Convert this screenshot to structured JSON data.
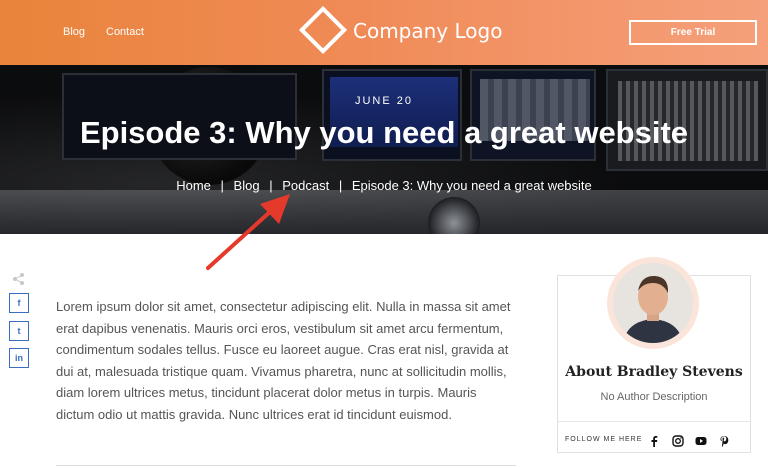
{
  "header": {
    "nav": {
      "blog": "Blog",
      "contact": "Contact"
    },
    "logo_text": "Company Logo",
    "trial_button": "Free Trial"
  },
  "hero": {
    "date": "JUNE 20",
    "title": "Episode 3: Why you need a great website",
    "breadcrumb": {
      "home": "Home",
      "blog": "Blog",
      "podcast": "Podcast",
      "current": "Episode 3: Why you need a great website",
      "separator": "|"
    }
  },
  "article": {
    "body": "Lorem ipsum dolor sit amet, consectetur adipiscing elit. Nulla in massa sit amet erat dapibus venenatis. Mauris orci eros, vestibulum sit amet arcu fermentum, condimentum sodales tellus. Fusce eu laoreet augue. Cras erat nisl, gravida at dui at, malesuada tristique quam. Vivamus pharetra, nunc at sollicitudin mollis, diam lorem ultrices metus, tincidunt placerat dolor metus in turpis. Mauris dictum odio ut mattis gravida. Nunc ultrices erat id tincidunt euismod."
  },
  "share": {
    "icons": [
      "share-icon",
      "facebook-icon",
      "twitter-icon",
      "linkedin-icon"
    ],
    "labels": {
      "facebook": "f",
      "twitter": "t",
      "linkedin": "in"
    }
  },
  "author": {
    "name": "About Bradley Stevens",
    "description": "No Author Description",
    "follow_label": "FOLLOW ME HERE",
    "social_icons": [
      "facebook-icon",
      "instagram-icon",
      "youtube-icon",
      "pinterest-icon"
    ]
  },
  "colors": {
    "header_start": "#e9843b",
    "header_end": "#f5a07b",
    "annotation_arrow": "#e53a2b",
    "share_blue": "#3a6ec2"
  }
}
